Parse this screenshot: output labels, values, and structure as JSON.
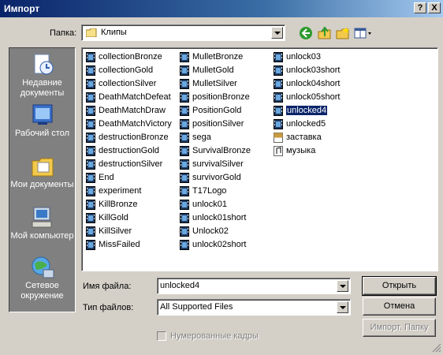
{
  "window": {
    "title": "Импорт",
    "help_btn": "?",
    "close_btn": "X"
  },
  "toolbar": {
    "folder_label": "Папка:",
    "folder_value": "Клипы"
  },
  "places": [
    {
      "label": "Недавние документы"
    },
    {
      "label": "Рабочий стол"
    },
    {
      "label": "Мои документы"
    },
    {
      "label": "Мой компьютер"
    },
    {
      "label": "Сетевое окружение"
    }
  ],
  "files": {
    "col1": [
      "collectionBronze",
      "collectionGold",
      "collectionSilver",
      "DeathMatchDefeat",
      "DeathMatchDraw",
      "DeathMatchVictory",
      "destructionBronze",
      "destructionGold",
      "destructionSilver",
      "End",
      "experiment",
      "KillBronze",
      "KillGold",
      "KillSilver",
      "MissFailed"
    ],
    "col2": [
      "MulletBronze",
      "MulletGold",
      "MulletSilver",
      "positionBronze",
      "PositionGold",
      "positionSilver",
      "sega",
      "SurvivalBronze",
      "survivalSilver",
      "survivorGold",
      "T17Logo",
      "unlock01",
      "unlock01short",
      "Unlock02",
      "unlock02short"
    ],
    "col3": [
      "unlock03",
      "unlock03short",
      "unlock04short",
      "unlock05short",
      "unlocked4",
      "unlocked5",
      "заставка",
      "музыка"
    ],
    "selected": "unlocked4"
  },
  "form": {
    "filename_label": "Имя файла:",
    "filename_value": "unlocked4",
    "filetype_label": "Тип файлов:",
    "filetype_value": "All Supported Files",
    "checkbox_label": "Нумерованные кадры"
  },
  "buttons": {
    "open": "Открыть",
    "cancel": "Отмена",
    "import_folder": "Импорт. Папку"
  }
}
